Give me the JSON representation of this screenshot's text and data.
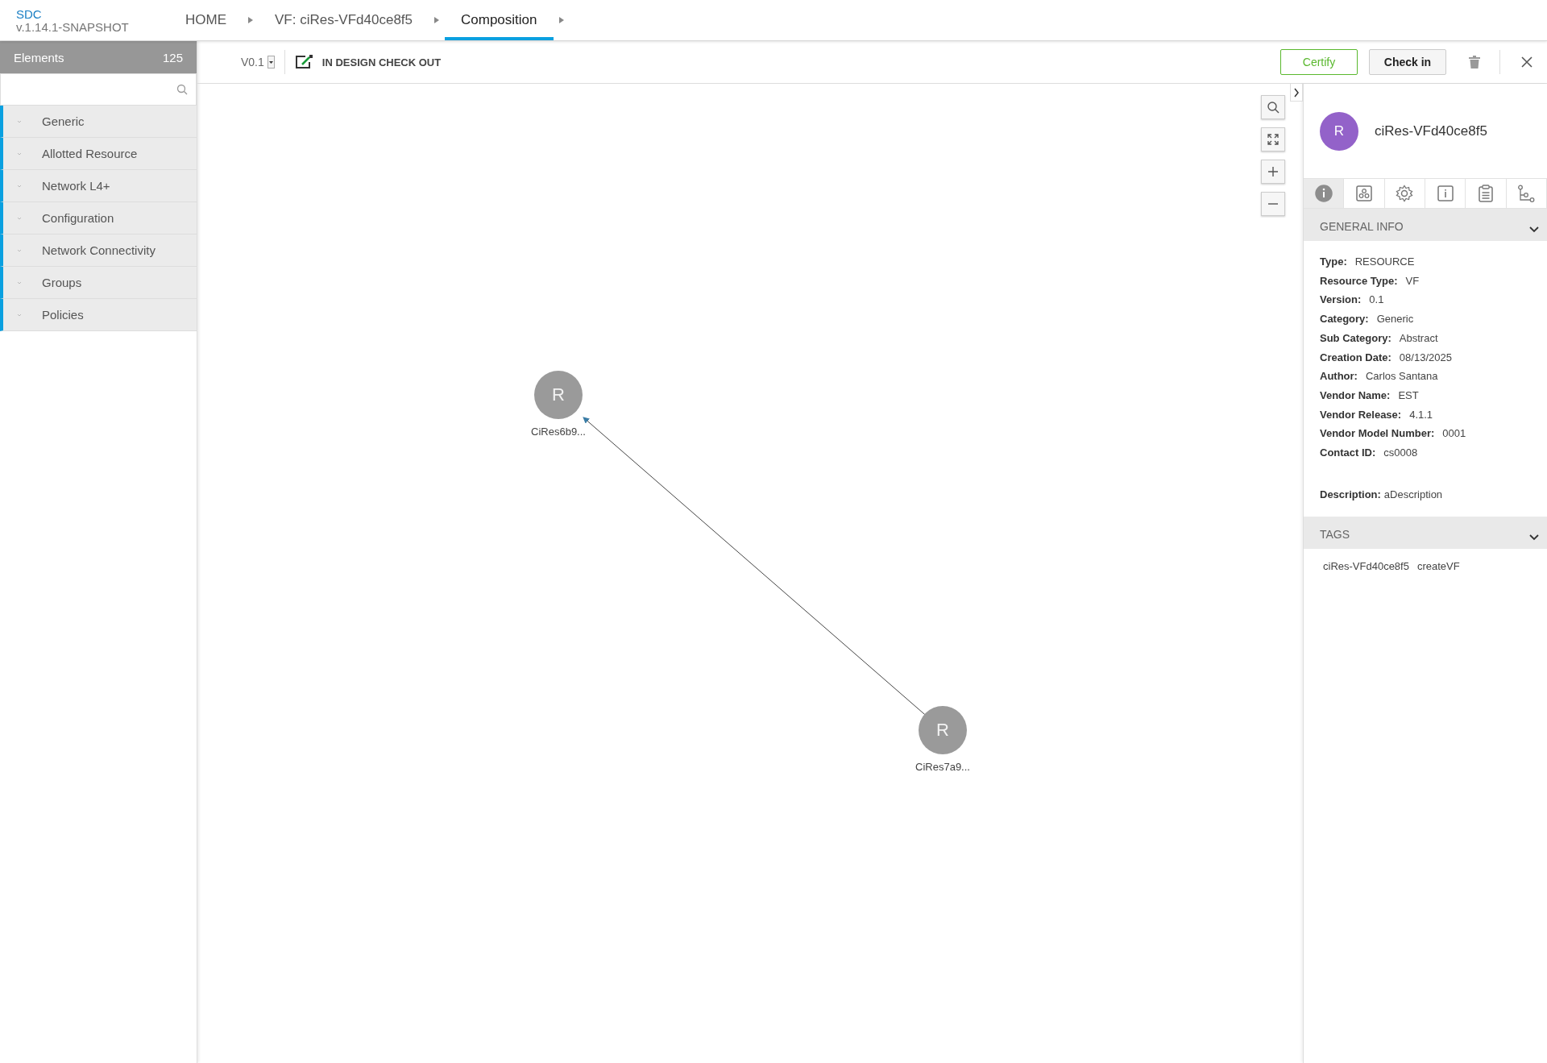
{
  "header": {
    "logo": "SDC",
    "version": "v.1.14.1-SNAPSHOT",
    "breadcrumbs": [
      {
        "label": "HOME",
        "selected": false
      },
      {
        "label": "VF: ciRes-VFd40ce8f5",
        "selected": false
      },
      {
        "label": "Composition",
        "selected": true
      }
    ]
  },
  "sidebar": {
    "title": "Elements",
    "count": "125",
    "categories": [
      {
        "label": "Generic",
        "expanded": false
      },
      {
        "label": "Allotted Resource",
        "expanded": false
      },
      {
        "label": "Network L4+",
        "expanded": false
      },
      {
        "label": "Configuration",
        "expanded": false
      },
      {
        "label": "Network Connectivity",
        "expanded": false
      },
      {
        "label": "Groups",
        "expanded": false
      },
      {
        "label": "Policies",
        "expanded": false
      }
    ]
  },
  "toolbar": {
    "version": "V0.1",
    "status": "IN DESIGN CHECK OUT",
    "buttons": [
      {
        "label": "Certify",
        "kind": "primary"
      },
      {
        "label": "Check in",
        "kind": "default"
      }
    ]
  },
  "canvas": {
    "nodes": [
      {
        "letter": "R",
        "label": "CiRes6b9..."
      },
      {
        "letter": "R",
        "label": "CiRes7a9..."
      }
    ]
  },
  "panel": {
    "avatar": "R",
    "title": "ciRes-VFd40ce8f5",
    "tabs": [
      {
        "kind": "info",
        "selected": true
      },
      {
        "kind": "composition",
        "selected": false
      },
      {
        "kind": "properties",
        "selected": false
      },
      {
        "kind": "details",
        "selected": false
      },
      {
        "kind": "artifacts",
        "selected": false
      },
      {
        "kind": "relations",
        "selected": false
      }
    ],
    "general_info": {
      "title": "GENERAL INFO",
      "expanded": true,
      "fields": [
        {
          "label": "Type:",
          "value": "RESOURCE"
        },
        {
          "label": "Resource Type:",
          "value": "VF"
        },
        {
          "label": "Version:",
          "value": "0.1"
        },
        {
          "label": "Category:",
          "value": "Generic"
        },
        {
          "label": "Sub Category:",
          "value": "Abstract"
        },
        {
          "label": "Creation Date:",
          "value": "08/13/2025"
        },
        {
          "label": "Author:",
          "value": "Carlos Santana"
        },
        {
          "label": "Vendor Name:",
          "value": "EST"
        },
        {
          "label": "Vendor Release:",
          "value": "4.1.1"
        },
        {
          "label": "Vendor Model Number:",
          "value": "0001"
        },
        {
          "label": "Contact ID:",
          "value": "cs0008"
        }
      ],
      "description": {
        "label": "Description:",
        "value": "aDescription"
      }
    },
    "tags": {
      "title": "TAGS",
      "expanded": true,
      "items": [
        "ciRes-VFd40ce8f5",
        "createVF"
      ]
    }
  }
}
